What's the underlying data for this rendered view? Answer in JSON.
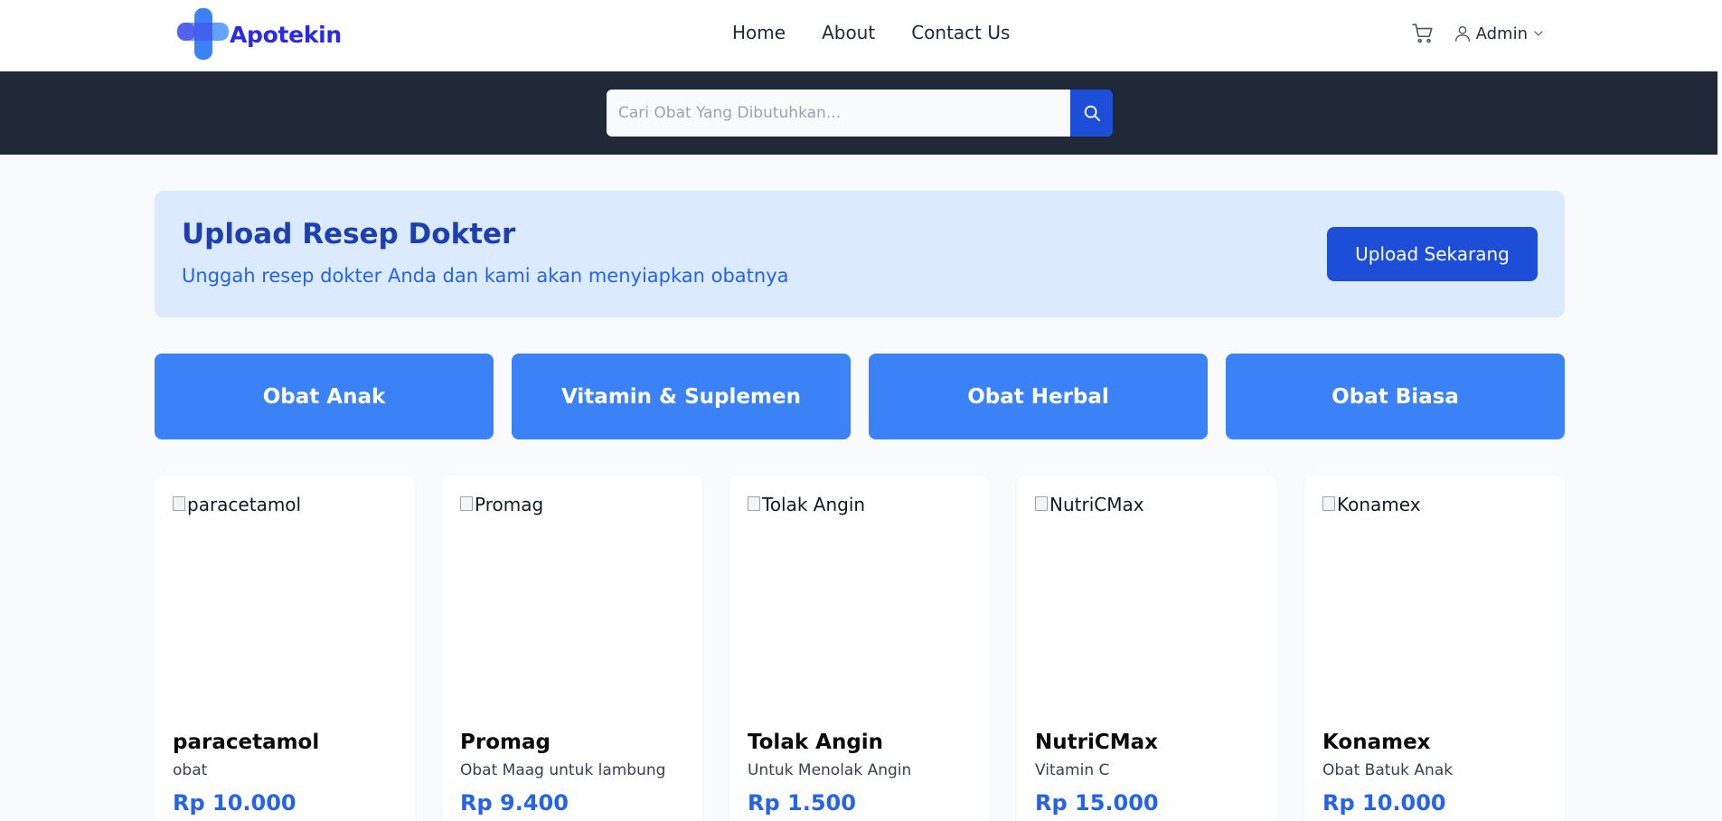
{
  "brand": {
    "name": "Apotekin",
    "primary": "#2a2ae6",
    "accent": "#3b82f6"
  },
  "nav": {
    "items": [
      "Home",
      "About",
      "Contact Us"
    ]
  },
  "header": {
    "cart_icon": "cart-icon",
    "user_icon": "user-icon",
    "user_label": "Admin"
  },
  "search": {
    "placeholder": "Cari Obat Yang Dibutuhkan...",
    "value": "",
    "icon": "search-icon"
  },
  "banner": {
    "title": "Upload Resep Dokter",
    "subtitle": "Unggah resep dokter Anda dan kami akan menyiapkan obatnya",
    "button": "Upload Sekarang"
  },
  "categories": [
    "Obat Anak",
    "Vitamin & Suplemen",
    "Obat Herbal",
    "Obat Biasa"
  ],
  "products": [
    {
      "img_alt": "paracetamol",
      "name": "paracetamol",
      "desc": "obat",
      "price": "Rp 10.000"
    },
    {
      "img_alt": "Promag",
      "name": "Promag",
      "desc": "Obat Maag untuk lambung",
      "price": "Rp 9.400"
    },
    {
      "img_alt": "Tolak Angin",
      "name": "Tolak Angin",
      "desc": "Untuk Menolak Angin",
      "price": "Rp 1.500"
    },
    {
      "img_alt": "NutriCMax",
      "name": "NutriCMax",
      "desc": "Vitamin C",
      "price": "Rp 15.000"
    },
    {
      "img_alt": "Konamex",
      "name": "Konamex",
      "desc": "Obat Batuk Anak",
      "price": "Rp 10.000"
    }
  ]
}
